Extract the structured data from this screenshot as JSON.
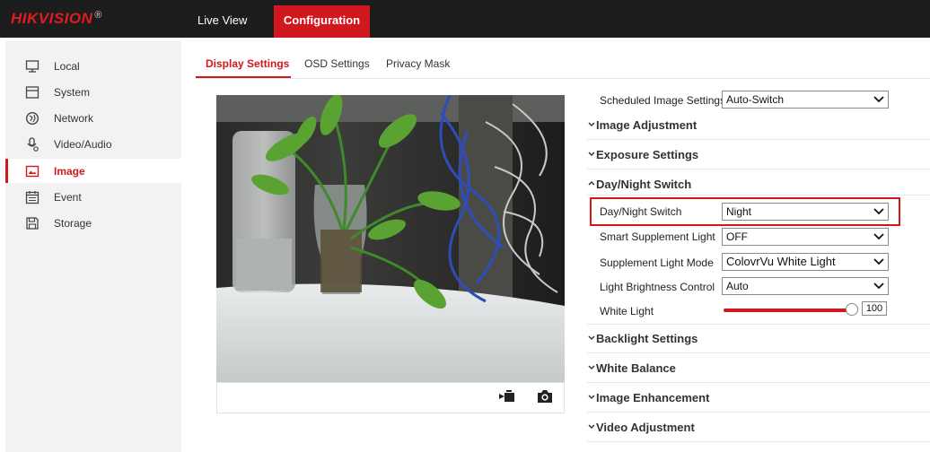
{
  "brand": {
    "name": "HIKVISION",
    "reg": "®"
  },
  "topnav": {
    "live_view": "Live View",
    "configuration": "Configuration"
  },
  "sidebar": {
    "items": [
      {
        "label": "Local",
        "icon": "monitor-icon"
      },
      {
        "label": "System",
        "icon": "system-icon"
      },
      {
        "label": "Network",
        "icon": "network-globe-icon"
      },
      {
        "label": "Video/Audio",
        "icon": "microphone-icon"
      },
      {
        "label": "Image",
        "icon": "image-icon",
        "active": true
      },
      {
        "label": "Event",
        "icon": "calendar-icon"
      },
      {
        "label": "Storage",
        "icon": "save-disk-icon"
      }
    ]
  },
  "subtabs": {
    "display": "Display Settings",
    "osd": "OSD Settings",
    "privacy": "Privacy Mask"
  },
  "video_toolbar": {
    "record_icon": "record-video-icon",
    "capture_icon": "camera-capture-icon"
  },
  "settings": {
    "scheduled_label": "Scheduled Image Settings",
    "scheduled_value": "Auto-Switch",
    "sections": {
      "image_adjustment": "Image Adjustment",
      "exposure": "Exposure Settings",
      "day_night": "Day/Night Switch",
      "backlight": "Backlight Settings",
      "white_balance": "White Balance",
      "image_enhancement": "Image Enhancement",
      "video_adjustment": "Video Adjustment"
    },
    "fields": {
      "day_night_label": "Day/Night Switch",
      "day_night_value": "Night",
      "smart_supp_label": "Smart Supplement Light",
      "smart_supp_value": "OFF",
      "supp_mode_label": "Supplement Light Mode",
      "supp_mode_value": "ColovrVu White Light",
      "brightness_ctrl_label": "Light Brightness Control",
      "brightness_ctrl_value": "Auto",
      "white_light_label": "White Light",
      "white_light_value": "100"
    }
  },
  "colors": {
    "accent": "#d1181e",
    "topbar": "#1d1d1d"
  }
}
